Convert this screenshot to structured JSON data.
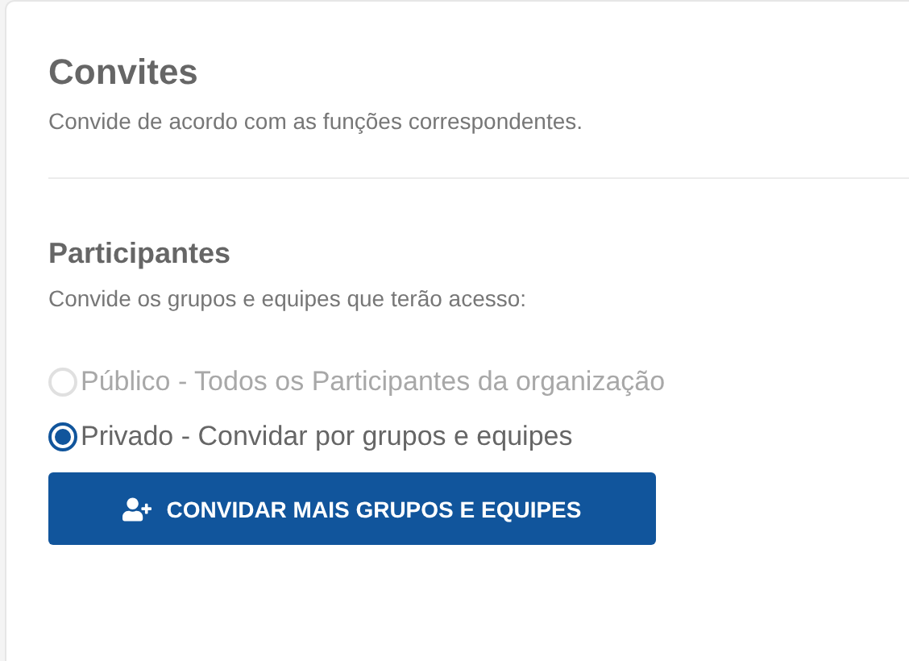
{
  "header": {
    "title": "Convites",
    "subtitle": "Convide de acordo com as funções correspondentes."
  },
  "participants": {
    "title": "Participantes",
    "description": "Convide os grupos e equipes que terão acesso:",
    "options": [
      {
        "label": "Público - Todos os Participantes da organização",
        "selected": false,
        "disabled": true
      },
      {
        "label": "Privado - Convidar por grupos e equipes",
        "selected": true,
        "disabled": false
      }
    ],
    "button": {
      "label": "CONVIDAR MAIS GRUPOS E EQUIPES"
    }
  }
}
